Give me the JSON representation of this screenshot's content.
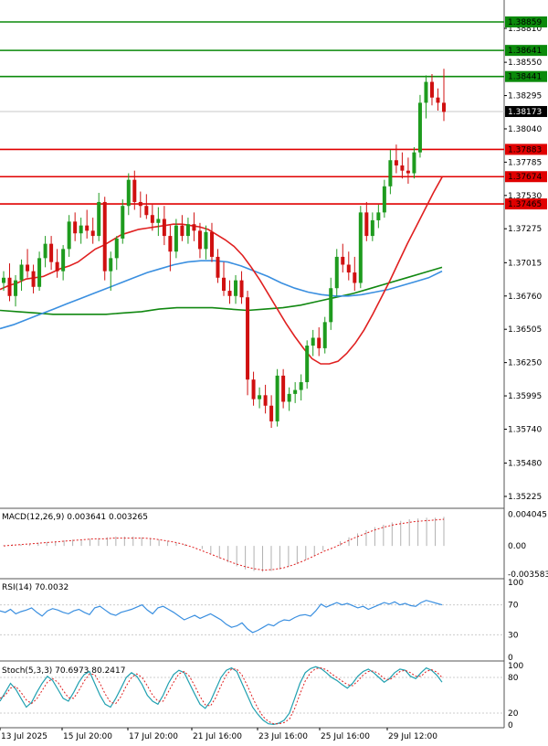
{
  "chart_data": {
    "type": "candlestick",
    "symbol_pair": "USDCAD",
    "y_ticks": [
      "1.38810",
      "1.38550",
      "1.38295",
      "1.38040",
      "1.37785",
      "1.37530",
      "1.37275",
      "1.37015",
      "1.36760",
      "1.36505",
      "1.36250",
      "1.35995",
      "1.35740",
      "1.35480",
      "1.35225"
    ],
    "last_price": "1.38173",
    "levels": [
      {
        "label": "1.38859",
        "value": 1.38859,
        "color": "#0b8a0b"
      },
      {
        "label": "1.38641",
        "value": 1.38641,
        "color": "#0b8a0b"
      },
      {
        "label": "1.38441",
        "value": 1.38441,
        "color": "#0b8a0b"
      },
      {
        "label": "1.37883",
        "value": 1.37883,
        "color": "#e00000"
      },
      {
        "label": "1.37674",
        "value": 1.37674,
        "color": "#e00000"
      },
      {
        "label": "1.37465",
        "value": 1.37465,
        "color": "#e00000"
      }
    ],
    "x_labels": [
      "13 Jul 2025",
      "15 Jul 20:00",
      "17 Jul 20:00",
      "21 Jul 16:00",
      "23 Jul 16:00",
      "25 Jul 16:00",
      "29 Jul 12:00"
    ],
    "candles": [
      [
        1.3686,
        1.3695,
        1.368,
        1.369
      ],
      [
        1.369,
        1.3701,
        1.3672,
        1.3676
      ],
      [
        1.3676,
        1.3692,
        1.3668,
        1.3688
      ],
      [
        1.3688,
        1.3704,
        1.368,
        1.37
      ],
      [
        1.37,
        1.3712,
        1.369,
        1.3695
      ],
      [
        1.3695,
        1.37,
        1.3678,
        1.3683
      ],
      [
        1.3683,
        1.371,
        1.368,
        1.3705
      ],
      [
        1.3705,
        1.3722,
        1.3698,
        1.3716
      ],
      [
        1.3716,
        1.3722,
        1.3696,
        1.3702
      ],
      [
        1.3702,
        1.3712,
        1.369,
        1.3695
      ],
      [
        1.3695,
        1.3715,
        1.3688,
        1.3712
      ],
      [
        1.3712,
        1.3738,
        1.3706,
        1.3733
      ],
      [
        1.3733,
        1.374,
        1.3718,
        1.3724
      ],
      [
        1.3724,
        1.3736,
        1.3716,
        1.373
      ],
      [
        1.373,
        1.3742,
        1.372,
        1.3726
      ],
      [
        1.3726,
        1.3736,
        1.3716,
        1.3722
      ],
      [
        1.3722,
        1.3755,
        1.3718,
        1.3748
      ],
      [
        1.3748,
        1.3752,
        1.3688,
        1.3695
      ],
      [
        1.3695,
        1.371,
        1.368,
        1.3705
      ],
      [
        1.3705,
        1.3722,
        1.3696,
        1.372
      ],
      [
        1.372,
        1.375,
        1.3716,
        1.3745
      ],
      [
        1.3745,
        1.377,
        1.3738,
        1.3765
      ],
      [
        1.3765,
        1.3772,
        1.3742,
        1.3748
      ],
      [
        1.3748,
        1.3756,
        1.3736,
        1.3745
      ],
      [
        1.3745,
        1.3754,
        1.3735,
        1.3738
      ],
      [
        1.3738,
        1.3746,
        1.3726,
        1.3732
      ],
      [
        1.3732,
        1.3744,
        1.3722,
        1.3735
      ],
      [
        1.3735,
        1.3745,
        1.3715,
        1.3722
      ],
      [
        1.3722,
        1.373,
        1.3695,
        1.371
      ],
      [
        1.371,
        1.3735,
        1.3705,
        1.373
      ],
      [
        1.373,
        1.3738,
        1.3718,
        1.3722
      ],
      [
        1.3722,
        1.3736,
        1.3716,
        1.3731
      ],
      [
        1.3731,
        1.374,
        1.3718,
        1.3726
      ],
      [
        1.3726,
        1.3732,
        1.3705,
        1.3712
      ],
      [
        1.3712,
        1.373,
        1.3704,
        1.3725
      ],
      [
        1.3725,
        1.3732,
        1.3702,
        1.3706
      ],
      [
        1.3706,
        1.3712,
        1.3686,
        1.369
      ],
      [
        1.369,
        1.3702,
        1.3676,
        1.368
      ],
      [
        1.368,
        1.3688,
        1.367,
        1.3676
      ],
      [
        1.3676,
        1.3692,
        1.367,
        1.3688
      ],
      [
        1.3688,
        1.3695,
        1.367,
        1.3675
      ],
      [
        1.3675,
        1.368,
        1.36,
        1.3612
      ],
      [
        1.3612,
        1.3618,
        1.3592,
        1.3597
      ],
      [
        1.3597,
        1.3606,
        1.359,
        1.36
      ],
      [
        1.36,
        1.3608,
        1.3586,
        1.3592
      ],
      [
        1.3592,
        1.36,
        1.3575,
        1.358
      ],
      [
        1.358,
        1.362,
        1.3576,
        1.3615
      ],
      [
        1.3615,
        1.362,
        1.359,
        1.3595
      ],
      [
        1.3595,
        1.3606,
        1.3588,
        1.3601
      ],
      [
        1.3601,
        1.361,
        1.3594,
        1.3604
      ],
      [
        1.3604,
        1.3616,
        1.3596,
        1.361
      ],
      [
        1.361,
        1.3642,
        1.3605,
        1.3638
      ],
      [
        1.3638,
        1.365,
        1.363,
        1.3644
      ],
      [
        1.3644,
        1.3652,
        1.363,
        1.3636
      ],
      [
        1.3636,
        1.366,
        1.3632,
        1.3656
      ],
      [
        1.3656,
        1.369,
        1.365,
        1.3682
      ],
      [
        1.3682,
        1.3712,
        1.3676,
        1.3706
      ],
      [
        1.3706,
        1.3716,
        1.3694,
        1.37
      ],
      [
        1.37,
        1.371,
        1.3688,
        1.3694
      ],
      [
        1.3694,
        1.3706,
        1.368,
        1.3686
      ],
      [
        1.3686,
        1.3745,
        1.3682,
        1.374
      ],
      [
        1.374,
        1.3748,
        1.3718,
        1.3722
      ],
      [
        1.3722,
        1.374,
        1.3718,
        1.3734
      ],
      [
        1.3734,
        1.3746,
        1.3728,
        1.374
      ],
      [
        1.374,
        1.3765,
        1.3736,
        1.376
      ],
      [
        1.376,
        1.3788,
        1.3754,
        1.378
      ],
      [
        1.378,
        1.3792,
        1.377,
        1.3776
      ],
      [
        1.3776,
        1.3786,
        1.3766,
        1.3772
      ],
      [
        1.3772,
        1.3782,
        1.3762,
        1.377
      ],
      [
        1.377,
        1.379,
        1.3766,
        1.3786
      ],
      [
        1.3786,
        1.383,
        1.3782,
        1.3824
      ],
      [
        1.3824,
        1.3845,
        1.3812,
        1.384
      ],
      [
        1.384,
        1.3846,
        1.3822,
        1.3828
      ],
      [
        1.3828,
        1.3835,
        1.3818,
        1.3824
      ],
      [
        1.3824,
        1.385,
        1.381,
        1.3817
      ]
    ],
    "ma_red": [
      1.3681,
      1.3684,
      1.3686,
      1.3689,
      1.369,
      1.3691,
      1.3694,
      1.3697,
      1.3699,
      1.3702,
      1.3707,
      1.3712,
      1.3715,
      1.3719,
      1.3723,
      1.3725,
      1.3727,
      1.3728,
      1.3729,
      1.373,
      1.3731,
      1.3731,
      1.373,
      1.3729,
      1.3727,
      1.3723,
      1.3719,
      1.3714,
      1.3707,
      1.3698,
      1.3688,
      1.3677,
      1.3666,
      1.3655,
      1.3645,
      1.3636,
      1.3628,
      1.3624,
      1.3624,
      1.3626,
      1.3632,
      1.364,
      1.365,
      1.3662,
      1.3675,
      1.3688,
      1.3702,
      1.3716,
      1.3729,
      1.3742,
      1.3755,
      1.3767
    ],
    "ma_red_start": 24,
    "ma_blue": [
      1.3651,
      1.3654,
      1.3658,
      1.3662,
      1.3666,
      1.367,
      1.3674,
      1.3678,
      1.3682,
      1.3686,
      1.369,
      1.3694,
      1.3697,
      1.37,
      1.3702,
      1.3703,
      1.3703,
      1.3702,
      1.3699,
      1.3695,
      1.3691,
      1.3686,
      1.3682,
      1.3679,
      1.3677,
      1.3676,
      1.3676,
      1.3677,
      1.3679,
      1.3681,
      1.3684,
      1.3687,
      1.369,
      1.3695
    ],
    "ma_green": [
      1.3665,
      1.3664,
      1.3663,
      1.3662,
      1.3662,
      1.3662,
      1.3662,
      1.3663,
      1.3664,
      1.3666,
      1.3667,
      1.3667,
      1.3667,
      1.3666,
      1.3665,
      1.3666,
      1.3667,
      1.3669,
      1.3672,
      1.3675,
      1.3678,
      1.3682,
      1.3686,
      1.369,
      1.3694,
      1.3698
    ],
    "macd": {
      "title": "MACD(12,26,9) 0.003641 0.003265",
      "ticks": [
        "0.004045",
        "0.00",
        "-0.003583"
      ],
      "range": [
        -0.0036,
        0.0041
      ],
      "hist": [
        0.0001,
        0.0002,
        0.0002,
        0.0003,
        0.0004,
        0.0005,
        0.0006,
        0.0007,
        0.0008,
        0.0008,
        0.0009,
        0.001,
        0.0011,
        0.0012,
        0.0012,
        0.0012,
        0.0011,
        0.001,
        0.0008,
        0.0006,
        0.0004,
        0.0002,
        0.0,
        -0.0004,
        -0.001,
        -0.0016,
        -0.0021,
        -0.0026,
        -0.003,
        -0.0032,
        -0.0033,
        -0.0032,
        -0.003,
        -0.0027,
        -0.0023,
        -0.0018,
        -0.0012,
        -0.0006,
        0.0,
        0.0006,
        0.0011,
        0.0016,
        0.002,
        0.0024,
        0.0027,
        0.003,
        0.0032,
        0.0034,
        0.0035,
        0.0036,
        0.0036,
        0.0037
      ],
      "signal": [
        0.0,
        0.0001,
        0.0002,
        0.0003,
        0.0004,
        0.0005,
        0.0006,
        0.0007,
        0.0008,
        0.0009,
        0.0009,
        0.001,
        0.001,
        0.001,
        0.001,
        0.0009,
        0.0007,
        0.0005,
        0.0002,
        -0.0002,
        -0.0007,
        -0.0012,
        -0.0017,
        -0.0022,
        -0.0026,
        -0.0029,
        -0.0031,
        -0.003,
        -0.0028,
        -0.0024,
        -0.0019,
        -0.0013,
        -0.0007,
        -0.0002,
        0.0004,
        0.001,
        0.0015,
        0.002,
        0.0024,
        0.0027,
        0.0029,
        0.0031,
        0.0032,
        0.0033,
        0.0034
      ]
    },
    "rsi": {
      "title": "RSI(14) 70.0032",
      "ticks": [
        "100",
        "70",
        "30",
        "0"
      ],
      "values": [
        62,
        60,
        64,
        58,
        61,
        63,
        66,
        60,
        55,
        62,
        65,
        63,
        60,
        58,
        62,
        64,
        60,
        57,
        66,
        68,
        63,
        58,
        56,
        60,
        62,
        64,
        67,
        70,
        63,
        58,
        66,
        68,
        64,
        60,
        55,
        50,
        53,
        56,
        52,
        55,
        58,
        54,
        50,
        44,
        40,
        42,
        46,
        38,
        33,
        36,
        40,
        44,
        42,
        47,
        50,
        49,
        53,
        56,
        57,
        55,
        62,
        71,
        67,
        70,
        73,
        70,
        72,
        69,
        66,
        68,
        64,
        67,
        70,
        73,
        71,
        74,
        70,
        72,
        69,
        68,
        73,
        76,
        74,
        72,
        70
      ],
      "range": [
        0,
        100
      ]
    },
    "stoch": {
      "title": "Stoch(5,3,3) 70.6973 80.2417",
      "ticks": [
        "100",
        "80",
        "20",
        "0"
      ],
      "k": [
        40,
        55,
        70,
        60,
        45,
        30,
        38,
        55,
        70,
        82,
        75,
        60,
        45,
        40,
        55,
        72,
        85,
        90,
        70,
        50,
        35,
        30,
        45,
        62,
        80,
        88,
        82,
        68,
        50,
        40,
        35,
        50,
        70,
        85,
        92,
        88,
        70,
        52,
        35,
        28,
        40,
        60,
        80,
        92,
        96,
        90,
        70,
        50,
        30,
        18,
        8,
        2,
        1,
        3,
        8,
        20,
        45,
        70,
        88,
        95,
        98,
        95,
        88,
        80,
        75,
        68,
        62,
        70,
        82,
        90,
        94,
        88,
        80,
        72,
        78,
        88,
        94,
        92,
        82,
        78,
        88,
        96,
        92,
        84,
        72
      ],
      "d": [
        45,
        50,
        62,
        65,
        55,
        42,
        36,
        44,
        58,
        72,
        78,
        72,
        58,
        46,
        45,
        58,
        74,
        86,
        85,
        70,
        52,
        38,
        36,
        48,
        66,
        80,
        86,
        80,
        66,
        50,
        40,
        40,
        56,
        72,
        86,
        90,
        82,
        66,
        48,
        34,
        32,
        46,
        66,
        84,
        94,
        94,
        84,
        66,
        46,
        28,
        14,
        6,
        2,
        2,
        4,
        10,
        28,
        52,
        74,
        88,
        95,
        96,
        93,
        86,
        80,
        74,
        68,
        66,
        74,
        84,
        90,
        91,
        86,
        78,
        76,
        82,
        90,
        92,
        88,
        82,
        82,
        90,
        93,
        89,
        80
      ],
      "range": [
        0,
        100
      ]
    }
  }
}
